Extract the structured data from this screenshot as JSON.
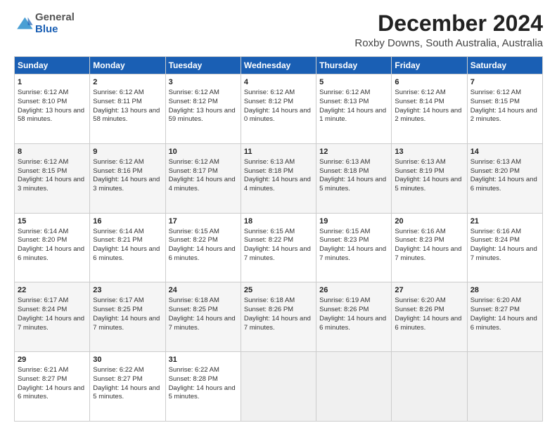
{
  "header": {
    "logo_general": "General",
    "logo_blue": "Blue",
    "main_title": "December 2024",
    "subtitle": "Roxby Downs, South Australia, Australia"
  },
  "calendar": {
    "days_of_week": [
      "Sunday",
      "Monday",
      "Tuesday",
      "Wednesday",
      "Thursday",
      "Friday",
      "Saturday"
    ],
    "weeks": [
      [
        {
          "day": "",
          "empty": true
        },
        {
          "day": "",
          "empty": true
        },
        {
          "day": "",
          "empty": true
        },
        {
          "day": "",
          "empty": true
        },
        {
          "day": "",
          "empty": true
        },
        {
          "day": "",
          "empty": true
        },
        {
          "day": "",
          "empty": true
        }
      ],
      [
        {
          "day": "1",
          "sunrise": "6:12 AM",
          "sunset": "8:10 PM",
          "daylight": "13 hours and 58 minutes."
        },
        {
          "day": "2",
          "sunrise": "6:12 AM",
          "sunset": "8:11 PM",
          "daylight": "13 hours and 58 minutes."
        },
        {
          "day": "3",
          "sunrise": "6:12 AM",
          "sunset": "8:12 PM",
          "daylight": "13 hours and 59 minutes."
        },
        {
          "day": "4",
          "sunrise": "6:12 AM",
          "sunset": "8:12 PM",
          "daylight": "14 hours and 0 minutes."
        },
        {
          "day": "5",
          "sunrise": "6:12 AM",
          "sunset": "8:13 PM",
          "daylight": "14 hours and 1 minute."
        },
        {
          "day": "6",
          "sunrise": "6:12 AM",
          "sunset": "8:14 PM",
          "daylight": "14 hours and 2 minutes."
        },
        {
          "day": "7",
          "sunrise": "6:12 AM",
          "sunset": "8:15 PM",
          "daylight": "14 hours and 2 minutes."
        }
      ],
      [
        {
          "day": "8",
          "sunrise": "6:12 AM",
          "sunset": "8:15 PM",
          "daylight": "14 hours and 3 minutes."
        },
        {
          "day": "9",
          "sunrise": "6:12 AM",
          "sunset": "8:16 PM",
          "daylight": "14 hours and 3 minutes."
        },
        {
          "day": "10",
          "sunrise": "6:12 AM",
          "sunset": "8:17 PM",
          "daylight": "14 hours and 4 minutes."
        },
        {
          "day": "11",
          "sunrise": "6:13 AM",
          "sunset": "8:18 PM",
          "daylight": "14 hours and 4 minutes."
        },
        {
          "day": "12",
          "sunrise": "6:13 AM",
          "sunset": "8:18 PM",
          "daylight": "14 hours and 5 minutes."
        },
        {
          "day": "13",
          "sunrise": "6:13 AM",
          "sunset": "8:19 PM",
          "daylight": "14 hours and 5 minutes."
        },
        {
          "day": "14",
          "sunrise": "6:13 AM",
          "sunset": "8:20 PM",
          "daylight": "14 hours and 6 minutes."
        }
      ],
      [
        {
          "day": "15",
          "sunrise": "6:14 AM",
          "sunset": "8:20 PM",
          "daylight": "14 hours and 6 minutes."
        },
        {
          "day": "16",
          "sunrise": "6:14 AM",
          "sunset": "8:21 PM",
          "daylight": "14 hours and 6 minutes."
        },
        {
          "day": "17",
          "sunrise": "6:15 AM",
          "sunset": "8:22 PM",
          "daylight": "14 hours and 6 minutes."
        },
        {
          "day": "18",
          "sunrise": "6:15 AM",
          "sunset": "8:22 PM",
          "daylight": "14 hours and 7 minutes."
        },
        {
          "day": "19",
          "sunrise": "6:15 AM",
          "sunset": "8:23 PM",
          "daylight": "14 hours and 7 minutes."
        },
        {
          "day": "20",
          "sunrise": "6:16 AM",
          "sunset": "8:23 PM",
          "daylight": "14 hours and 7 minutes."
        },
        {
          "day": "21",
          "sunrise": "6:16 AM",
          "sunset": "8:24 PM",
          "daylight": "14 hours and 7 minutes."
        }
      ],
      [
        {
          "day": "22",
          "sunrise": "6:17 AM",
          "sunset": "8:24 PM",
          "daylight": "14 hours and 7 minutes."
        },
        {
          "day": "23",
          "sunrise": "6:17 AM",
          "sunset": "8:25 PM",
          "daylight": "14 hours and 7 minutes."
        },
        {
          "day": "24",
          "sunrise": "6:18 AM",
          "sunset": "8:25 PM",
          "daylight": "14 hours and 7 minutes."
        },
        {
          "day": "25",
          "sunrise": "6:18 AM",
          "sunset": "8:26 PM",
          "daylight": "14 hours and 7 minutes."
        },
        {
          "day": "26",
          "sunrise": "6:19 AM",
          "sunset": "8:26 PM",
          "daylight": "14 hours and 6 minutes."
        },
        {
          "day": "27",
          "sunrise": "6:20 AM",
          "sunset": "8:26 PM",
          "daylight": "14 hours and 6 minutes."
        },
        {
          "day": "28",
          "sunrise": "6:20 AM",
          "sunset": "8:27 PM",
          "daylight": "14 hours and 6 minutes."
        }
      ],
      [
        {
          "day": "29",
          "sunrise": "6:21 AM",
          "sunset": "8:27 PM",
          "daylight": "14 hours and 6 minutes."
        },
        {
          "day": "30",
          "sunrise": "6:22 AM",
          "sunset": "8:27 PM",
          "daylight": "14 hours and 5 minutes."
        },
        {
          "day": "31",
          "sunrise": "6:22 AM",
          "sunset": "8:28 PM",
          "daylight": "14 hours and 5 minutes."
        },
        {
          "day": "",
          "empty": true
        },
        {
          "day": "",
          "empty": true
        },
        {
          "day": "",
          "empty": true
        },
        {
          "day": "",
          "empty": true
        }
      ]
    ]
  }
}
